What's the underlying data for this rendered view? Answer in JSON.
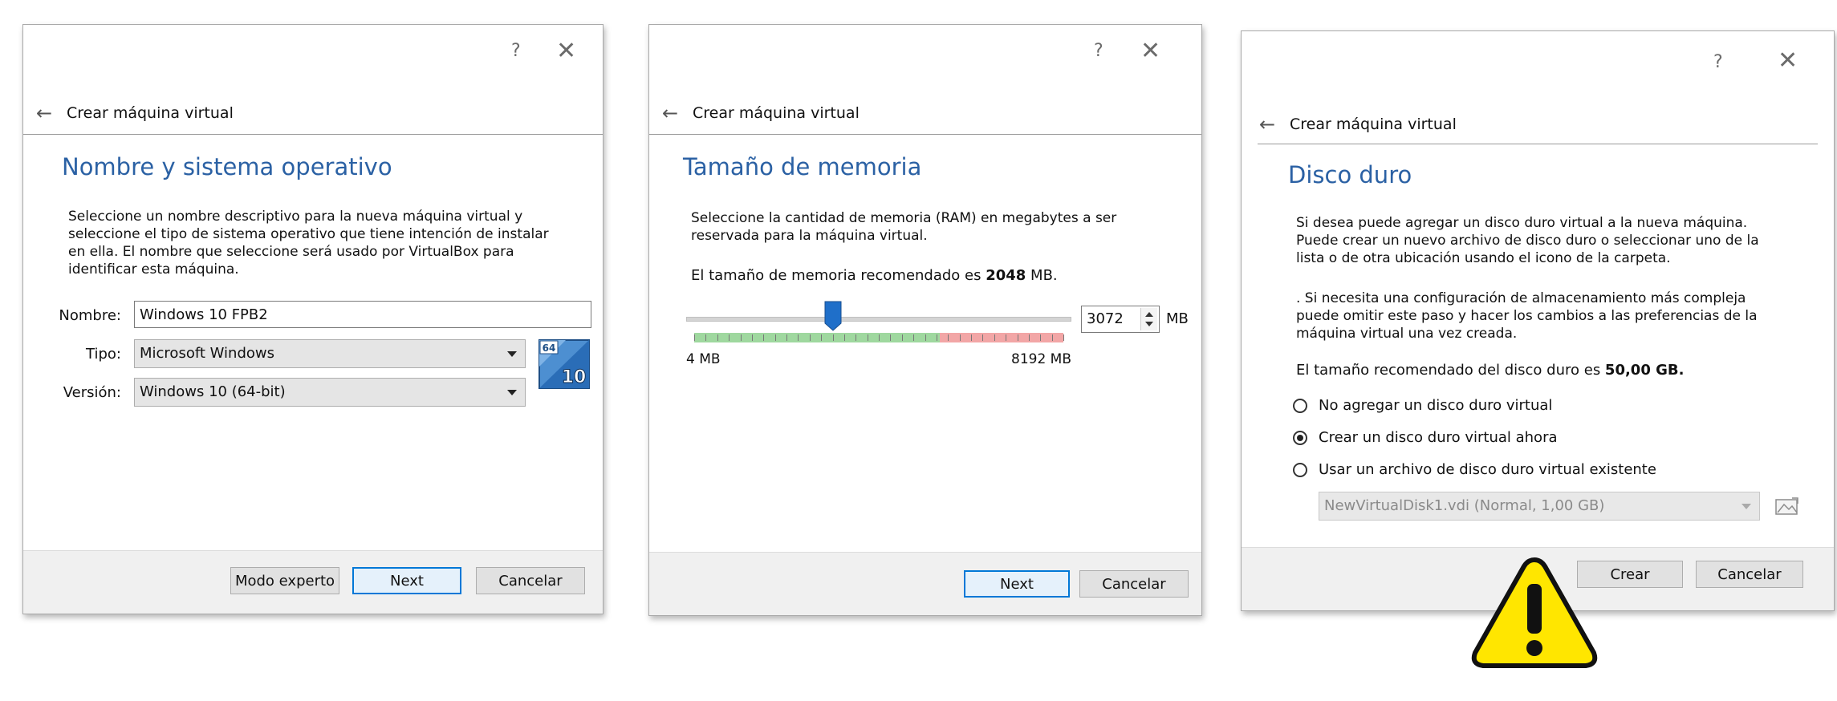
{
  "dialog1": {
    "help": "?",
    "close": "✕",
    "back": "←",
    "title": "Crear máquina virtual",
    "heading": "Nombre y sistema operativo",
    "desc_l1": "Seleccione un nombre descriptivo para la nueva máquina virtual y",
    "desc_l2": "seleccione el tipo de sistema operativo que tiene intención de instalar",
    "desc_l3": "en ella. El nombre que seleccione será usado por VirtualBox para",
    "desc_l4": "identificar esta máquina.",
    "name_label": "Nombre:",
    "name_value": "Windows 10 FPB2",
    "type_label": "Tipo:",
    "type_value": "Microsoft Windows",
    "version_label": "Versión:",
    "version_value": "Windows 10 (64-bit)",
    "os_icon_top": "64",
    "os_icon_bottom": "10",
    "btn_expert": "Modo experto",
    "btn_next": "Next",
    "btn_cancel": "Cancelar"
  },
  "dialog2": {
    "help": "?",
    "close": "✕",
    "back": "←",
    "title": "Crear máquina virtual",
    "heading": "Tamaño de memoria",
    "desc_l1": "Seleccione la cantidad de memoria (RAM) en megabytes a ser",
    "desc_l2": "reservada para la máquina virtual.",
    "recommended_prefix": "El tamaño de memoria recomendado es ",
    "recommended_value": "2048",
    "recommended_suffix": " MB.",
    "slider_min_label": "4 MB",
    "slider_max_label": "8192 MB",
    "memory_value": "3072",
    "unit": "MB",
    "slider_fraction": 0.375,
    "colors": {
      "green": "#9fd89f",
      "red": "#f2a6a6",
      "thumb": "#1f6fc9"
    },
    "btn_next": "Next",
    "btn_cancel": "Cancelar"
  },
  "dialog3": {
    "help": "?",
    "close": "✕",
    "back": "←",
    "title": "Crear máquina virtual",
    "heading": "Disco duro",
    "p1_l1": "Si desea puede agregar un disco duro virtual a la nueva máquina.",
    "p1_l2": "Puede crear un nuevo archivo de disco duro o seleccionar uno de la",
    "p1_l3": "lista o de otra ubicación usando el icono de la carpeta.",
    "p2_l1": ". Si necesita una configuración de almacenamiento más compleja",
    "p2_l2": "puede omitir este paso y hacer los cambios a las preferencias de la",
    "p2_l3": "máquina virtual una vez creada.",
    "recommended_prefix": "El tamaño recomendado del disco duro es ",
    "recommended_value": "50,00 GB.",
    "radio1": "No agregar un disco duro virtual",
    "radio2": "Crear un disco duro virtual ahora",
    "radio3": "Usar un archivo de disco duro virtual existente",
    "selected_radio": 2,
    "disk_value": "NewVirtualDisk1.vdi (Normal, 1,00 GB)",
    "btn_create": "Crear",
    "btn_cancel": "Cancelar"
  },
  "warning": {
    "symbol": "!",
    "fill": "#ffe600",
    "stroke": "#111111"
  }
}
